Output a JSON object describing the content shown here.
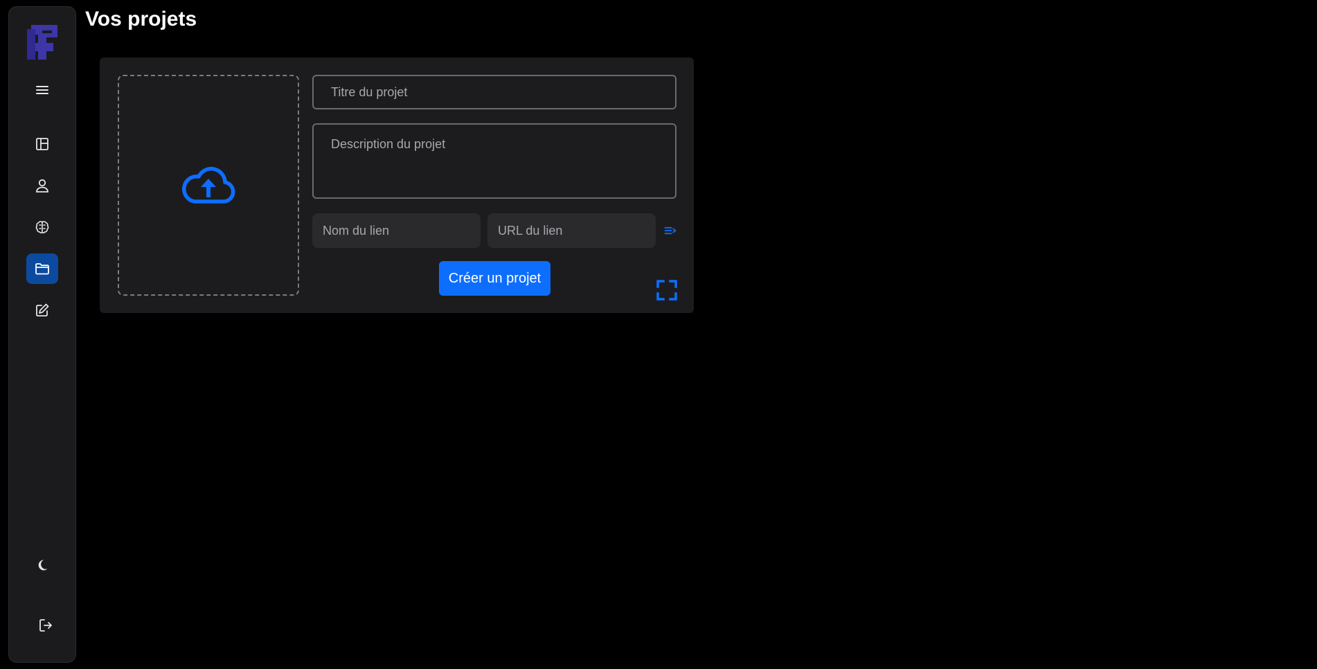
{
  "page": {
    "title": "Vos projets"
  },
  "sidebar": {
    "logo": "brand-logo",
    "items": [
      {
        "name": "menu-icon",
        "active": false
      },
      {
        "name": "dashboard-layout-icon",
        "active": false
      },
      {
        "name": "user-icon",
        "active": false
      },
      {
        "name": "brain-icon",
        "active": false
      },
      {
        "name": "folder-icon",
        "active": true
      },
      {
        "name": "edit-icon",
        "active": false
      },
      {
        "name": "moon-icon",
        "active": false
      },
      {
        "name": "logout-icon",
        "active": false
      }
    ]
  },
  "form": {
    "upload_icon": "cloud-upload-icon",
    "title_placeholder": "Titre du projet",
    "title_value": "",
    "description_placeholder": "Description du projet",
    "description_value": "",
    "link_name_placeholder": "Nom du lien",
    "link_url_placeholder": "URL du lien",
    "add_link_icon": "add-list-icon",
    "submit_label": "Créer un projet",
    "fullscreen_icon": "fullscreen-icon"
  },
  "colors": {
    "accent": "#0d6efd",
    "active_nav": "#0c4aa0",
    "logo": "#3d36a8",
    "card_bg": "#1c1c1e"
  }
}
